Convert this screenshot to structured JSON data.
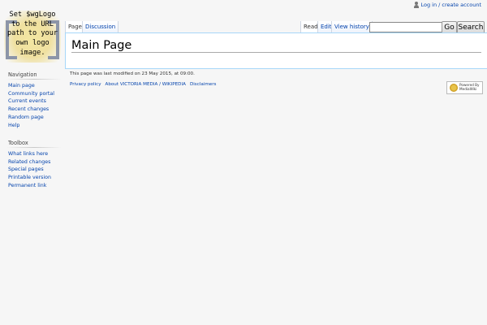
{
  "logo": {
    "text": "Set $wgLogo\nto the URL\npath to your\nown logo\nimage."
  },
  "personal": {
    "login_label": "Log in / create account"
  },
  "tabs": {
    "page": "Page",
    "discussion": "Discussion",
    "read": "Read",
    "edit": "Edit",
    "history": "View history"
  },
  "search": {
    "value": "",
    "go_label": "Go",
    "search_label": "Search"
  },
  "content": {
    "title": "Main Page"
  },
  "sidebar": {
    "navigation": {
      "heading": "Navigation",
      "items": [
        "Main page",
        "Community portal",
        "Current events",
        "Recent changes",
        "Random page",
        "Help"
      ]
    },
    "toolbox": {
      "heading": "Toolbox",
      "items": [
        "What links here",
        "Related changes",
        "Special pages",
        "Printable version",
        "Permanent link"
      ]
    }
  },
  "footer": {
    "lastmod": "This page was last modified on 23 May 2015, at 09:00.",
    "links": [
      "Privacy policy",
      "About VICTORIA MEDIA / WIKIPEDIA",
      "Disclaimers"
    ],
    "poweredby": {
      "line1": "Powered By",
      "line2": "MediaWiki"
    }
  }
}
